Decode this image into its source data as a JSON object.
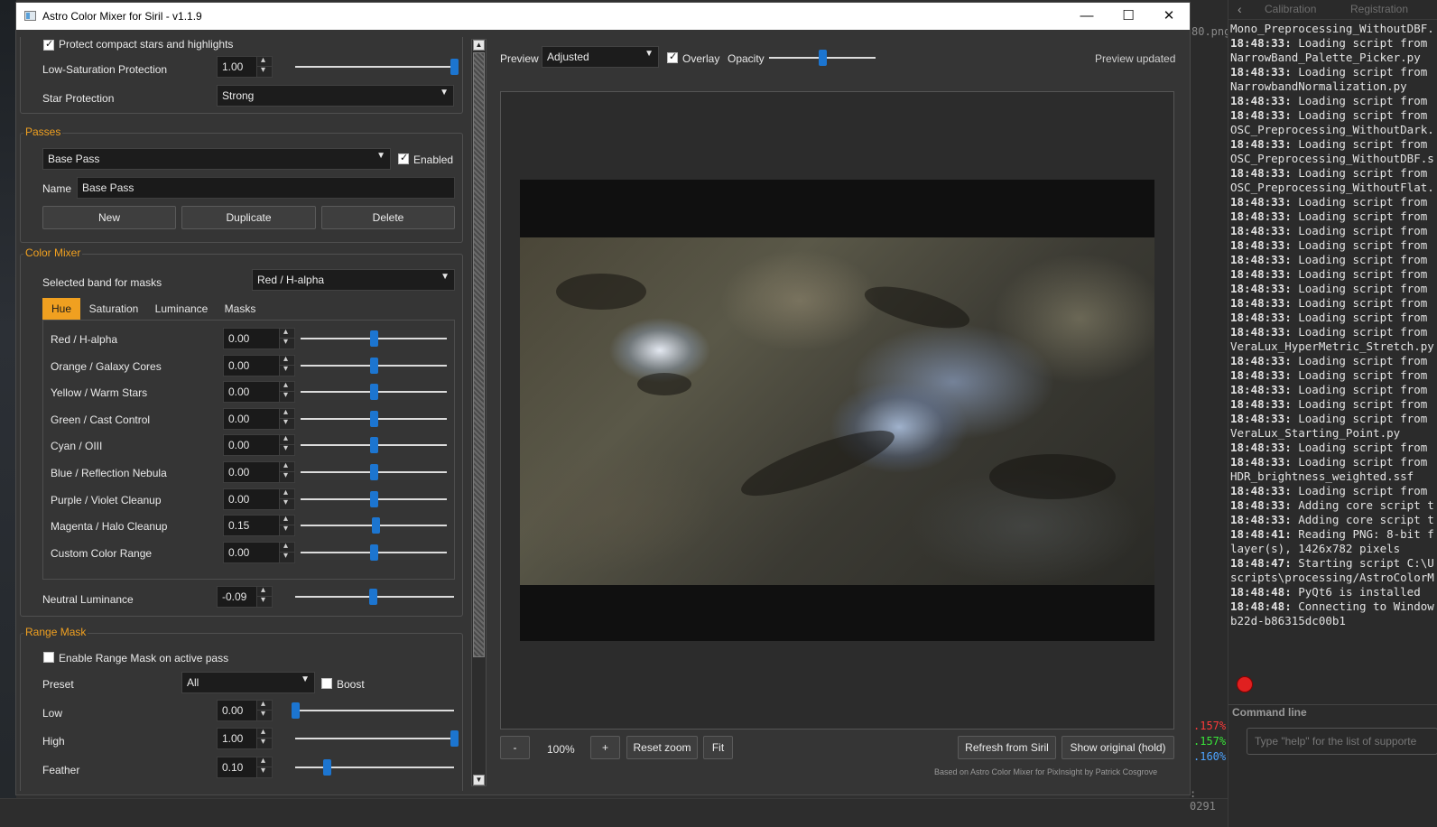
{
  "window": {
    "title": "Astro Color Mixer for Siril - v1.1.9"
  },
  "background_app": {
    "tabs": [
      "Calibration",
      "Registration"
    ],
    "file_fragment": "80.png",
    "percentages": [
      ".157%",
      ".157%",
      ".160%"
    ],
    "percent_colors": [
      "#ff3a3a",
      "#39e639",
      "#4da3ff"
    ],
    "counter": ": 0291",
    "log_lines": [
      {
        "ts": "",
        "text": "Mono_Preprocessing_WithoutDBF."
      },
      {
        "ts": "18:48:33:",
        "text": " Loading script from"
      },
      {
        "ts": "",
        "text": "NarrowBand_Palette_Picker.py"
      },
      {
        "ts": "18:48:33:",
        "text": " Loading script from"
      },
      {
        "ts": "",
        "text": "NarrowbandNormalization.py"
      },
      {
        "ts": "18:48:33:",
        "text": " Loading script from"
      },
      {
        "ts": "18:48:33:",
        "text": " Loading script from"
      },
      {
        "ts": "",
        "text": "OSC_Preprocessing_WithoutDark."
      },
      {
        "ts": "18:48:33:",
        "text": " Loading script from"
      },
      {
        "ts": "",
        "text": "OSC_Preprocessing_WithoutDBF.s"
      },
      {
        "ts": "18:48:33:",
        "text": " Loading script from"
      },
      {
        "ts": "",
        "text": "OSC_Preprocessing_WithoutFlat."
      },
      {
        "ts": "18:48:33:",
        "text": " Loading script from"
      },
      {
        "ts": "18:48:33:",
        "text": " Loading script from"
      },
      {
        "ts": "18:48:33:",
        "text": " Loading script from"
      },
      {
        "ts": "18:48:33:",
        "text": " Loading script from"
      },
      {
        "ts": "18:48:33:",
        "text": " Loading script from"
      },
      {
        "ts": "18:48:33:",
        "text": " Loading script from"
      },
      {
        "ts": "18:48:33:",
        "text": " Loading script from"
      },
      {
        "ts": "18:48:33:",
        "text": " Loading script from"
      },
      {
        "ts": "18:48:33:",
        "text": " Loading script from"
      },
      {
        "ts": "18:48:33:",
        "text": " Loading script from"
      },
      {
        "ts": "",
        "text": "VeraLux_HyperMetric_Stretch.py"
      },
      {
        "ts": "18:48:33:",
        "text": " Loading script from"
      },
      {
        "ts": "18:48:33:",
        "text": " Loading script from"
      },
      {
        "ts": "18:48:33:",
        "text": " Loading script from"
      },
      {
        "ts": "18:48:33:",
        "text": " Loading script from"
      },
      {
        "ts": "18:48:33:",
        "text": " Loading script from"
      },
      {
        "ts": "",
        "text": "VeraLux_Starting_Point.py"
      },
      {
        "ts": "18:48:33:",
        "text": " Loading script from"
      },
      {
        "ts": "18:48:33:",
        "text": " Loading script from"
      },
      {
        "ts": "",
        "text": "HDR_brightness_weighted.ssf"
      },
      {
        "ts": "18:48:33:",
        "text": " Loading script from"
      },
      {
        "ts": "18:48:33:",
        "text": " Adding core script t"
      },
      {
        "ts": "18:48:33:",
        "text": " Adding core script t"
      },
      {
        "ts": "18:48:41:",
        "text": " Reading PNG: 8-bit f"
      },
      {
        "ts": "",
        "text": "layer(s), 1426x782 pixels"
      },
      {
        "ts": "18:48:47:",
        "text": " Starting script C:\\U"
      },
      {
        "ts": "",
        "text": "scripts\\processing/AstroColorM"
      },
      {
        "ts": "18:48:48:",
        "text": " PyQt6 is installed"
      },
      {
        "ts": "18:48:48:",
        "text": " Connecting to Window"
      },
      {
        "ts": "",
        "text": "b22d-b86315dc00b1"
      }
    ],
    "command_line_label": "Command line",
    "command_placeholder": "Type \"help\" for the list of supporte"
  },
  "top_options": {
    "protect_label": "Protect compact stars and highlights",
    "protect_checked": true,
    "low_sat_label": "Low-Saturation Protection",
    "low_sat_value": "1.00",
    "low_sat_fraction": 1.0,
    "star_label": "Star Protection",
    "star_value": "Strong"
  },
  "passes": {
    "title": "Passes",
    "selected": "Base Pass",
    "enabled_label": "Enabled",
    "enabled": true,
    "name_label": "Name",
    "name_value": "Base Pass",
    "buttons": [
      "New",
      "Duplicate",
      "Delete"
    ]
  },
  "color_mixer": {
    "title": "Color Mixer",
    "band_label": "Selected band for masks",
    "band_value": "Red / H-alpha",
    "tabs": [
      "Hue",
      "Saturation",
      "Luminance",
      "Masks"
    ],
    "active_tab": "Hue",
    "rows": [
      {
        "label": "Red / H-alpha",
        "value": "0.00",
        "fraction": 0.5
      },
      {
        "label": "Orange / Galaxy Cores",
        "value": "0.00",
        "fraction": 0.5
      },
      {
        "label": "Yellow / Warm Stars",
        "value": "0.00",
        "fraction": 0.5
      },
      {
        "label": "Green / Cast Control",
        "value": "0.00",
        "fraction": 0.5
      },
      {
        "label": "Cyan / OIII",
        "value": "0.00",
        "fraction": 0.5
      },
      {
        "label": "Blue / Reflection Nebula",
        "value": "0.00",
        "fraction": 0.5
      },
      {
        "label": "Purple / Violet Cleanup",
        "value": "0.00",
        "fraction": 0.5
      },
      {
        "label": "Magenta / Halo Cleanup",
        "value": "0.15",
        "fraction": 0.51
      },
      {
        "label": "Custom Color Range",
        "value": "0.00",
        "fraction": 0.5
      }
    ],
    "neutral_label": "Neutral Luminance",
    "neutral_value": "-0.09",
    "neutral_fraction": 0.49
  },
  "range_mask": {
    "title": "Range Mask",
    "enable_label": "Enable Range Mask on active pass",
    "enable_checked": false,
    "preset_label": "Preset",
    "preset_value": "All",
    "boost_label": "Boost",
    "boost_checked": false,
    "low_label": "Low",
    "low_value": "0.00",
    "low_fraction": 0.0,
    "high_label": "High",
    "high_value": "1.00",
    "high_fraction": 1.0,
    "feather_label": "Feather",
    "feather_value": "0.10",
    "feather_fraction": 0.2
  },
  "preview": {
    "label": "Preview",
    "mode": "Adjusted",
    "overlay_label": "Overlay",
    "overlay_checked": true,
    "opacity_label": "Opacity",
    "opacity_fraction": 0.5,
    "status": "Preview updated",
    "zoom_minus": "-",
    "zoom_value": "100%",
    "zoom_plus": "+",
    "reset_zoom": "Reset zoom",
    "fit": "Fit",
    "refresh": "Refresh from Siril",
    "show_original": "Show original (hold)",
    "credit": "Based on Astro Color Mixer for PixInsight by Patrick Cosgrove"
  }
}
